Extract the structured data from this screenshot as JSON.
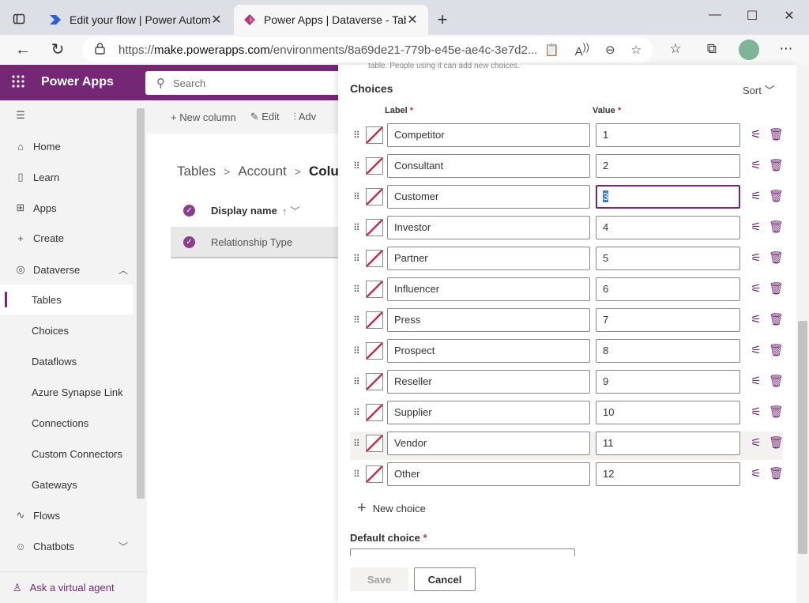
{
  "browser": {
    "tabs": [
      {
        "title": "Edit your flow | Power Automate",
        "active": false
      },
      {
        "title": "Power Apps | Dataverse - Tables |",
        "active": true
      }
    ],
    "url_prefix": "https://",
    "url_host": "make.powerapps.com",
    "url_path": "/environments/8a69de21-779b-e45e-ae4c-3e7d2..."
  },
  "app": {
    "name": "Power Apps",
    "search_placeholder": "Search"
  },
  "nav": {
    "items": [
      {
        "label": "Home",
        "icon": "home-icon"
      },
      {
        "label": "Learn",
        "icon": "book-icon"
      },
      {
        "label": "Apps",
        "icon": "apps-icon"
      },
      {
        "label": "Create",
        "icon": "plus-icon"
      },
      {
        "label": "Dataverse",
        "icon": "dataverse-icon"
      },
      {
        "label": "Tables"
      },
      {
        "label": "Choices"
      },
      {
        "label": "Dataflows"
      },
      {
        "label": "Azure Synapse Link"
      },
      {
        "label": "Connections"
      },
      {
        "label": "Custom Connectors"
      },
      {
        "label": "Gateways"
      },
      {
        "label": "Flows",
        "icon": "flows-icon"
      },
      {
        "label": "Chatbots",
        "icon": "chatbot-icon"
      }
    ],
    "selected": "Tables",
    "virtual_agent": "Ask a virtual agent"
  },
  "main": {
    "commands": [
      "New column",
      "Edit",
      "Adv"
    ],
    "breadcrumb": [
      "Tables",
      "Account",
      "Colum"
    ],
    "grid_header": "Display name",
    "grid_row": "Relationship Type"
  },
  "panel": {
    "top_text": "table. People using it can add new choices.",
    "title": "Choices",
    "sort_label": "Sort",
    "col_label": "Label",
    "col_value": "Value",
    "required_mark": "*",
    "choices": [
      {
        "label": "Competitor",
        "value": "1"
      },
      {
        "label": "Consultant",
        "value": "2"
      },
      {
        "label": "Customer",
        "value": "3"
      },
      {
        "label": "Investor",
        "value": "4"
      },
      {
        "label": "Partner",
        "value": "5"
      },
      {
        "label": "Influencer",
        "value": "6"
      },
      {
        "label": "Press",
        "value": "7"
      },
      {
        "label": "Prospect",
        "value": "8"
      },
      {
        "label": "Reseller",
        "value": "9"
      },
      {
        "label": "Supplier",
        "value": "10"
      },
      {
        "label": "Vendor",
        "value": "11"
      },
      {
        "label": "Other",
        "value": "12"
      }
    ],
    "focused_index": 2,
    "hovered_index": 10,
    "new_choice": "New choice",
    "default_choice_label": "Default choice",
    "save": "Save",
    "cancel": "Cancel"
  },
  "colors": {
    "brand": "#742774",
    "delete": "#742774"
  }
}
